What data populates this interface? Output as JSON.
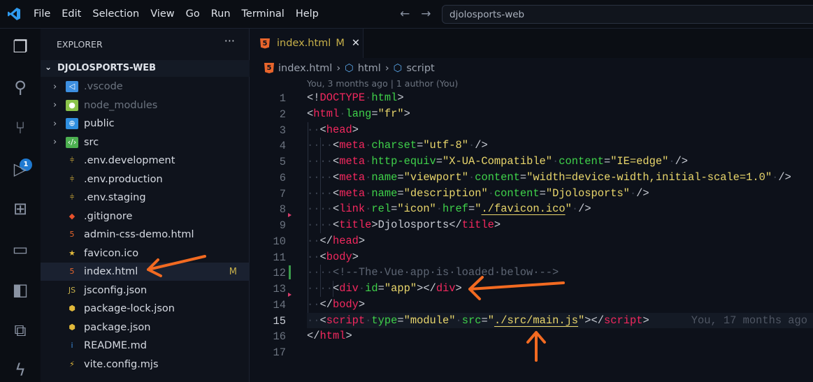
{
  "menu": [
    "File",
    "Edit",
    "Selection",
    "View",
    "Go",
    "Run",
    "Terminal",
    "Help"
  ],
  "search": "djolosports-web",
  "activity": {
    "scm_badge": "1"
  },
  "sidebar": {
    "title": "EXPLORER",
    "more": "···",
    "root": "DJOLOSPORTS-WEB",
    "items": [
      {
        "label": ".vscode",
        "folder": true,
        "dim": true,
        "icon": "vscode-folder-icon",
        "color": "#3d8fe0",
        "glyph": "◁"
      },
      {
        "label": "node_modules",
        "folder": true,
        "dim": true,
        "icon": "node-folder-icon",
        "color": "#8bc34a",
        "glyph": "●"
      },
      {
        "label": "public",
        "folder": true,
        "icon": "public-folder-icon",
        "color": "#2f8fe0",
        "glyph": "⊕"
      },
      {
        "label": "src",
        "folder": true,
        "icon": "src-folder-icon",
        "color": "#4caf50",
        "glyph": "‹/›"
      },
      {
        "label": ".env.development",
        "icon": "env-icon",
        "color": "",
        "glyph": "⫩"
      },
      {
        "label": ".env.production",
        "icon": "env-icon",
        "color": "",
        "glyph": "⫩"
      },
      {
        "label": ".env.staging",
        "icon": "env-icon",
        "color": "",
        "glyph": "⫩"
      },
      {
        "label": ".gitignore",
        "icon": "git-icon",
        "color": "#e8512c",
        "glyph": "◆"
      },
      {
        "label": "admin-css-demo.html",
        "icon": "html-icon",
        "color": "#e8652c",
        "glyph": "5"
      },
      {
        "label": "favicon.ico",
        "icon": "star-icon",
        "color": "",
        "glyph": "★"
      },
      {
        "label": "index.html",
        "icon": "html-icon",
        "color": "#e8652c",
        "glyph": "5",
        "selected": true,
        "status": "M"
      },
      {
        "label": "jsconfig.json",
        "icon": "js-config-icon",
        "color": "#c7b04a",
        "glyph": "JS"
      },
      {
        "label": "package-lock.json",
        "icon": "nodejs-icon",
        "color": "",
        "glyph": "⬢"
      },
      {
        "label": "package.json",
        "icon": "nodejs-icon",
        "color": "",
        "glyph": "⬢"
      },
      {
        "label": "README.md",
        "icon": "info-icon",
        "color": "#3d8fe0",
        "glyph": "i"
      },
      {
        "label": "vite.config.mjs",
        "icon": "vite-icon",
        "color": "",
        "glyph": "⚡"
      }
    ]
  },
  "tab": {
    "label": "index.html",
    "status": "M",
    "close": "✕"
  },
  "breadcrumb": [
    "index.html",
    "html",
    "script"
  ],
  "blame_header": "You, 3 months ago | 1 author (You)",
  "blame_inline": "You, 17 months ago",
  "code": [
    [
      [
        "pun",
        "<!"
      ],
      [
        "tag",
        "DOCTYPE"
      ],
      [
        "ws",
        "·"
      ],
      [
        "attr",
        "html"
      ],
      [
        "pun",
        ">"
      ]
    ],
    [
      [
        "pun",
        "<"
      ],
      [
        "tag",
        "html"
      ],
      [
        "ws",
        "·"
      ],
      [
        "attr",
        "lang"
      ],
      [
        "pun",
        "="
      ],
      [
        "str",
        "\"fr\""
      ],
      [
        "pun",
        ">"
      ]
    ],
    [
      [
        "ws",
        "··"
      ],
      [
        "pun",
        "<"
      ],
      [
        "tag",
        "head"
      ],
      [
        "pun",
        ">"
      ]
    ],
    [
      [
        "ws",
        "····"
      ],
      [
        "pun",
        "<"
      ],
      [
        "tag",
        "meta"
      ],
      [
        "ws",
        "·"
      ],
      [
        "attr",
        "charset"
      ],
      [
        "pun",
        "="
      ],
      [
        "str",
        "\"utf-8\""
      ],
      [
        "ws",
        "·"
      ],
      [
        "pun",
        "/>"
      ]
    ],
    [
      [
        "ws",
        "····"
      ],
      [
        "pun",
        "<"
      ],
      [
        "tag",
        "meta"
      ],
      [
        "ws",
        "·"
      ],
      [
        "attr",
        "http-equiv"
      ],
      [
        "pun",
        "="
      ],
      [
        "str",
        "\"X-UA-Compatible\""
      ],
      [
        "ws",
        "·"
      ],
      [
        "attr",
        "content"
      ],
      [
        "pun",
        "="
      ],
      [
        "str",
        "\"IE=edge\""
      ],
      [
        "ws",
        "·"
      ],
      [
        "pun",
        "/>"
      ]
    ],
    [
      [
        "ws",
        "····"
      ],
      [
        "pun",
        "<"
      ],
      [
        "tag",
        "meta"
      ],
      [
        "ws",
        "·"
      ],
      [
        "attr",
        "name"
      ],
      [
        "pun",
        "="
      ],
      [
        "str",
        "\"viewport\""
      ],
      [
        "ws",
        "·"
      ],
      [
        "attr",
        "content"
      ],
      [
        "pun",
        "="
      ],
      [
        "str",
        "\"width=device-width,initial-scale=1.0\""
      ],
      [
        "ws",
        "·"
      ],
      [
        "pun",
        "/>"
      ]
    ],
    [
      [
        "ws",
        "····"
      ],
      [
        "pun",
        "<"
      ],
      [
        "tag",
        "meta"
      ],
      [
        "ws",
        "·"
      ],
      [
        "attr",
        "name"
      ],
      [
        "pun",
        "="
      ],
      [
        "str",
        "\"description\""
      ],
      [
        "ws",
        "·"
      ],
      [
        "attr",
        "content"
      ],
      [
        "pun",
        "="
      ],
      [
        "str",
        "\"Djolosports\""
      ],
      [
        "ws",
        "·"
      ],
      [
        "pun",
        "/>"
      ]
    ],
    [
      [
        "ws",
        "····"
      ],
      [
        "pun",
        "<"
      ],
      [
        "tag",
        "link"
      ],
      [
        "ws",
        "·"
      ],
      [
        "attr",
        "rel"
      ],
      [
        "pun",
        "="
      ],
      [
        "str",
        "\"icon\""
      ],
      [
        "ws",
        "·"
      ],
      [
        "attr",
        "href"
      ],
      [
        "pun",
        "="
      ],
      [
        "str",
        "\""
      ],
      [
        "link",
        "./favicon.ico"
      ],
      [
        "str",
        "\""
      ],
      [
        "ws",
        "·"
      ],
      [
        "pun",
        "/>"
      ]
    ],
    [
      [
        "ws",
        "····"
      ],
      [
        "pun",
        "<"
      ],
      [
        "tag",
        "title"
      ],
      [
        "pun",
        ">Djolosports</"
      ],
      [
        "tag",
        "title"
      ],
      [
        "pun",
        ">"
      ]
    ],
    [
      [
        "ws",
        "··"
      ],
      [
        "pun",
        "</"
      ],
      [
        "tag",
        "head"
      ],
      [
        "pun",
        ">"
      ]
    ],
    [
      [
        "ws",
        "··"
      ],
      [
        "pun",
        "<"
      ],
      [
        "tag",
        "body"
      ],
      [
        "pun",
        ">"
      ]
    ],
    [
      [
        "ws",
        "····"
      ],
      [
        "com",
        "<!--The·Vue·app·is·loaded·below·-->"
      ]
    ],
    [
      [
        "ws",
        "····"
      ],
      [
        "pun",
        "<"
      ],
      [
        "tag",
        "div"
      ],
      [
        "ws",
        "·"
      ],
      [
        "attr",
        "id"
      ],
      [
        "pun",
        "="
      ],
      [
        "str",
        "\"app\""
      ],
      [
        "pun",
        "></"
      ],
      [
        "tag",
        "div"
      ],
      [
        "pun",
        ">"
      ]
    ],
    [
      [
        "ws",
        "··"
      ],
      [
        "pun",
        "</"
      ],
      [
        "tag",
        "body"
      ],
      [
        "pun",
        ">"
      ]
    ],
    [
      [
        "ws",
        "··"
      ],
      [
        "pun",
        "<"
      ],
      [
        "tag",
        "script"
      ],
      [
        "ws",
        "·"
      ],
      [
        "attr",
        "type"
      ],
      [
        "pun",
        "="
      ],
      [
        "str",
        "\"module\""
      ],
      [
        "ws",
        "·"
      ],
      [
        "attr",
        "src"
      ],
      [
        "pun",
        "="
      ],
      [
        "str",
        "\""
      ],
      [
        "link",
        "./src/main.js"
      ],
      [
        "str",
        "\""
      ],
      [
        "pun",
        "></"
      ],
      [
        "tag",
        "script"
      ],
      [
        "pun",
        ">"
      ]
    ],
    [
      [
        "pun",
        "</"
      ],
      [
        "tag",
        "html"
      ],
      [
        "pun",
        ">"
      ]
    ],
    []
  ]
}
